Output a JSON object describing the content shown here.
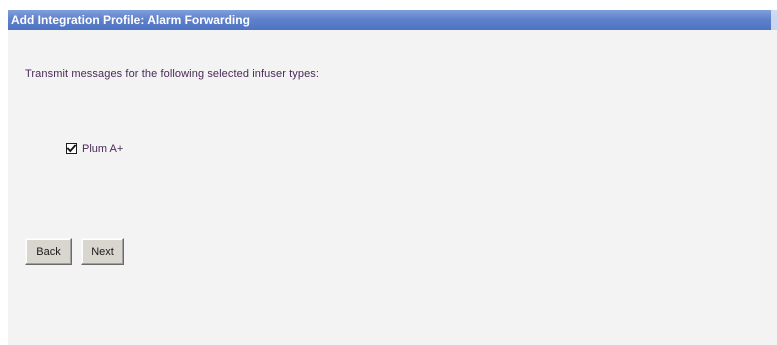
{
  "window": {
    "title": "Add Integration Profile: Alarm Forwarding"
  },
  "content": {
    "instructions": "Transmit messages for the following selected infuser types:",
    "infuser_types": [
      {
        "label": "Plum A+",
        "checked": true
      }
    ]
  },
  "buttons": {
    "back_label": "Back",
    "next_label": "Next"
  },
  "colors": {
    "title_bar": "#5f82cc",
    "title_text": "#ffffff",
    "body_text": "#4b2a57",
    "background": "#f3f3f3",
    "button_face": "#d9d6cf"
  }
}
